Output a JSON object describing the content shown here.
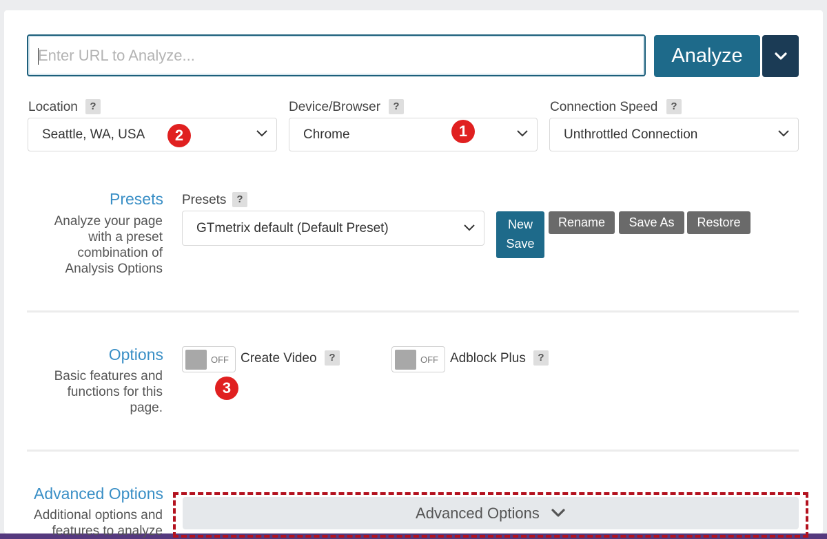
{
  "url_bar": {
    "placeholder": "Enter URL to Analyze...",
    "analyze_label": "Analyze",
    "dropdown_icon": "chevron-down-icon"
  },
  "fields": {
    "location": {
      "label": "Location",
      "help": "?",
      "value": "Seattle, WA, USA"
    },
    "device": {
      "label": "Device/Browser",
      "help": "?",
      "value": "Chrome"
    },
    "connection": {
      "label": "Connection Speed",
      "help": "?",
      "value": "Unthrottled Connection"
    }
  },
  "markers": {
    "m1": "1",
    "m2": "2",
    "m3": "3"
  },
  "presets_section": {
    "title": "Presets",
    "desc_lines": [
      "Analyze your page",
      "with a preset",
      "combination of",
      "Analysis Options"
    ],
    "field_label": "Presets",
    "help": "?",
    "value": "GTmetrix default (Default Preset)",
    "buttons": {
      "new_line1": "New",
      "new_line2": "Save",
      "rename": "Rename",
      "save_as": "Save As",
      "restore": "Restore"
    }
  },
  "options_section": {
    "title": "Options",
    "desc_lines": [
      "Basic features and",
      "functions for this",
      "page."
    ],
    "create_video": {
      "state": "OFF",
      "label": "Create Video",
      "help": "?"
    },
    "adblock": {
      "state": "OFF",
      "label": "Adblock Plus",
      "help": "?"
    }
  },
  "advanced_section": {
    "title": "Advanced Options",
    "desc_lines": [
      "Additional options and",
      "features to analyze"
    ],
    "button_label": "Advanced Options"
  },
  "colors": {
    "primary": "#1e6a8a",
    "dark": "#1b3b55",
    "link": "#3a8fc6",
    "marker": "#e02020",
    "annotation": "#b3121f"
  }
}
